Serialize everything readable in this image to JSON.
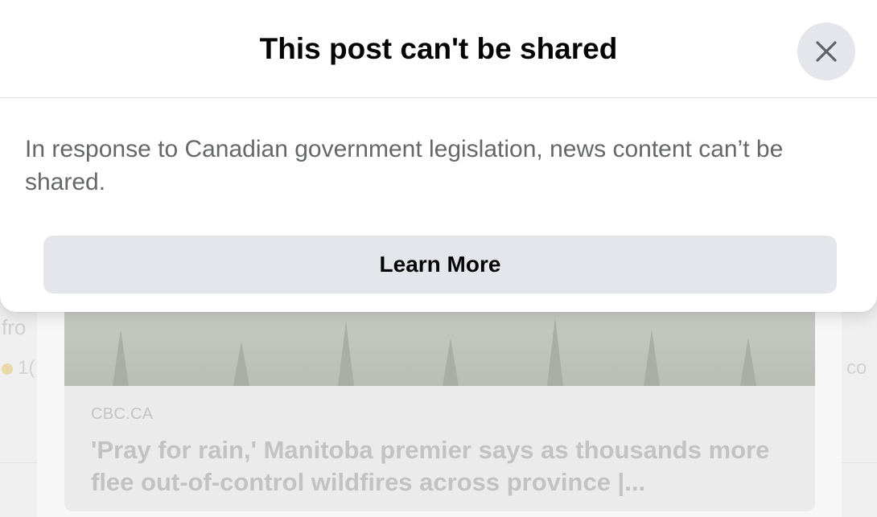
{
  "modal": {
    "title": "This post can't be shared",
    "body": "In response to Canadian government legislation, news content can’t be shared.",
    "learn_more_label": "Learn More",
    "close_icon": "close-icon"
  },
  "background_post": {
    "link_source": "CBC.CA",
    "link_headline": "'Pray for rain,' Manitoba premier says as thousands more flee out-of-control wildfires across province |...",
    "left_fragment": "fro",
    "count_fragment": "1(",
    "right_fragment": "co"
  },
  "colors": {
    "title_text": "#050505",
    "body_text": "#65676b",
    "button_bg": "#e4e6eb",
    "divider": "#dcdde0"
  }
}
